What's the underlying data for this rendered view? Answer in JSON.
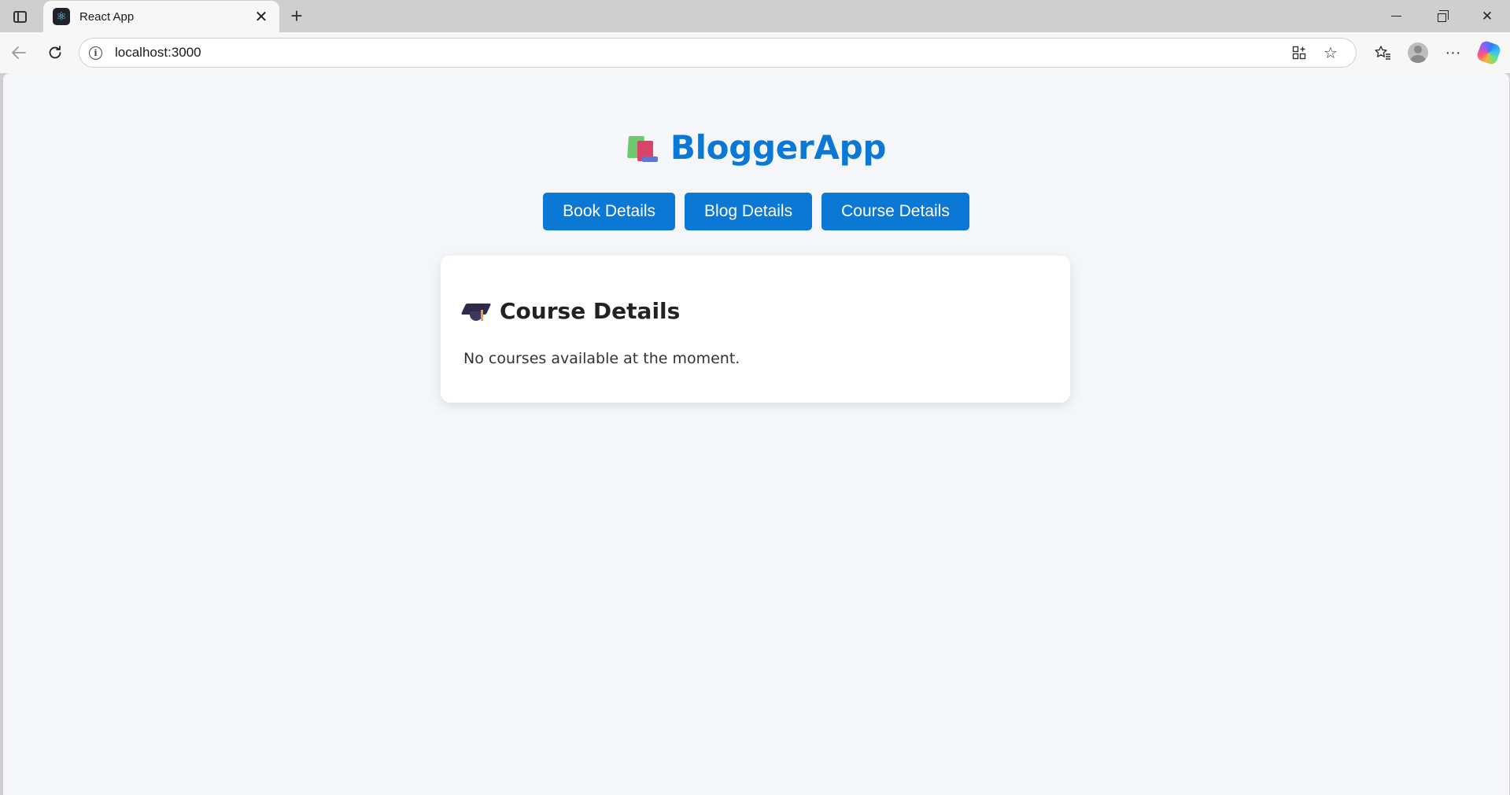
{
  "browser": {
    "tab": {
      "title": "React App",
      "favicon": "react-icon"
    },
    "address": {
      "url": "localhost:3000"
    },
    "icons": {
      "sidebar_toggle": "sidebar-toggle-icon",
      "close_tab": "close-icon",
      "new_tab": "plus-icon",
      "back": "back-arrow-icon",
      "reload": "reload-icon",
      "site_info": "info-icon",
      "app_available": "app-available-icon",
      "favorite": "star-icon",
      "favorites_list": "favorites-icon",
      "profile": "avatar-icon",
      "more": "more-icon",
      "copilot": "copilot-icon"
    }
  },
  "app": {
    "title": "BloggerApp",
    "title_icon": "books-icon",
    "accent_color": "#0a78d4",
    "nav": [
      {
        "label": "Book Details"
      },
      {
        "label": "Blog Details"
      },
      {
        "label": "Course Details"
      }
    ],
    "section": {
      "icon": "graduation-cap-icon",
      "heading": "Course Details",
      "message": "No courses available at the moment."
    }
  }
}
